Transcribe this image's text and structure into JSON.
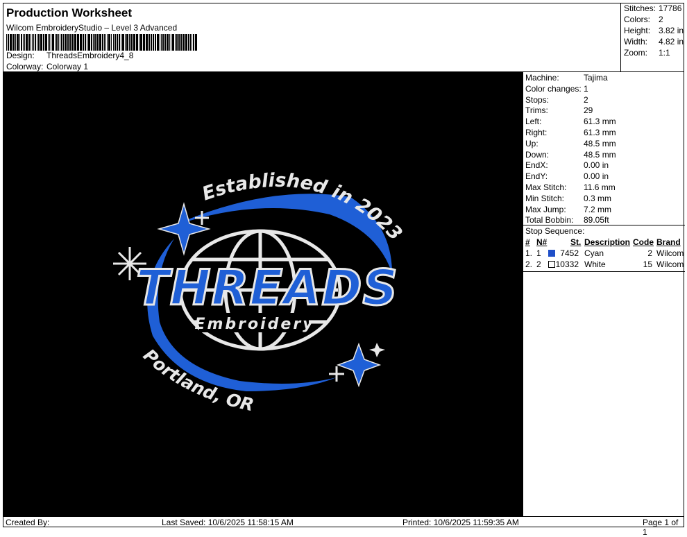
{
  "header": {
    "title": "Production Worksheet",
    "software": "Wilcom EmbroideryStudio – Level 3 Advanced",
    "design_label": "Design:",
    "design_value": "ThreadsEmbroidery4_8",
    "colorway_label": "Colorway:",
    "colorway_value": "Colorway 1"
  },
  "summary": {
    "stitches_label": "Stitches:",
    "stitches_value": "17786",
    "colors_label": "Colors:",
    "colors_value": "2",
    "height_label": "Height:",
    "height_value": "3.82 in",
    "width_label": "Width:",
    "width_value": "4.82 in",
    "zoom_label": "Zoom:",
    "zoom_value": "1:1"
  },
  "design_art": {
    "top_arc": "Established in 2023",
    "main_word": "THREADS",
    "sub_word": "Embroidery",
    "bottom_arc": "Portland, OR",
    "blue": "#1f5fd6",
    "white": "#e8e8e8"
  },
  "machine_info": [
    {
      "k": "Machine:",
      "v": "Tajima"
    },
    {
      "k": "Color changes:",
      "v": "1"
    },
    {
      "k": "Stops:",
      "v": "2"
    },
    {
      "k": "Trims:",
      "v": "29"
    },
    {
      "k": "Left:",
      "v": "61.3 mm"
    },
    {
      "k": "Right:",
      "v": "61.3 mm"
    },
    {
      "k": "Up:",
      "v": "48.5 mm"
    },
    {
      "k": "Down:",
      "v": "48.5 mm"
    },
    {
      "k": "EndX:",
      "v": "0.00 in"
    },
    {
      "k": "EndY:",
      "v": "0.00 in"
    },
    {
      "k": "Max Stitch:",
      "v": "11.6 mm"
    },
    {
      "k": "Min Stitch:",
      "v": "0.3 mm"
    },
    {
      "k": "Max Jump:",
      "v": "7.2 mm"
    },
    {
      "k": "Total Bobbin:",
      "v": "89.05ft"
    }
  ],
  "stop_sequence": {
    "title": "Stop Sequence:",
    "headers": {
      "num": "#",
      "n": "N#",
      "st": "St.",
      "desc": "Description",
      "code": "Code",
      "brand": "Brand"
    },
    "rows": [
      {
        "num": "1.",
        "n": "1",
        "st": "7452",
        "desc": "Cyan",
        "code": "2",
        "brand": "Wilcom",
        "color": "#1f4fc8"
      },
      {
        "num": "2.",
        "n": "2",
        "st": "10332",
        "desc": "White",
        "code": "15",
        "brand": "Wilcom",
        "color": "#ffffff"
      }
    ]
  },
  "footer": {
    "created": "Created By:",
    "saved": "Last Saved: 10/6/2025 11:58:15 AM",
    "printed": "Printed: 10/6/2025 11:59:35 AM",
    "page": "Page 1 of 1"
  }
}
